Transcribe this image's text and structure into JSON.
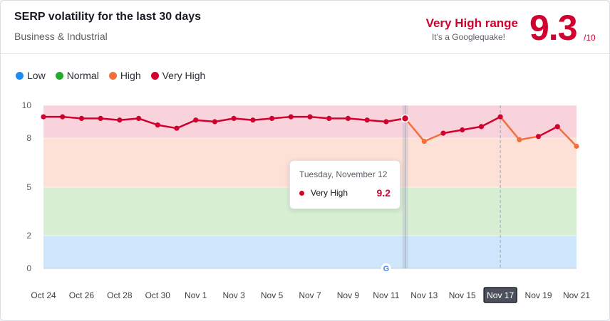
{
  "header": {
    "title": "SERP volatility for the last 30 days",
    "category": "Business & Industrial",
    "range_label": "Very High range",
    "range_sub": "It's a Googlequake!",
    "score": "9.3",
    "score_max": "/10"
  },
  "legend": [
    {
      "label": "Low",
      "color": "#1e8cf0"
    },
    {
      "label": "Normal",
      "color": "#27a82f"
    },
    {
      "label": "High",
      "color": "#f56f3a"
    },
    {
      "label": "Very High",
      "color": "#d1002f"
    }
  ],
  "tooltip": {
    "date": "Tuesday, November 12",
    "label": "Very High",
    "value": "9.2"
  },
  "chart_data": {
    "type": "line",
    "x": [
      "Oct 24",
      "Oct 25",
      "Oct 26",
      "Oct 27",
      "Oct 28",
      "Oct 29",
      "Oct 30",
      "Oct 31",
      "Nov 1",
      "Nov 2",
      "Nov 3",
      "Nov 4",
      "Nov 5",
      "Nov 6",
      "Nov 7",
      "Nov 8",
      "Nov 9",
      "Nov 10",
      "Nov 11",
      "Nov 12",
      "Nov 13",
      "Nov 14",
      "Nov 15",
      "Nov 16",
      "Nov 17",
      "Nov 18",
      "Nov 19",
      "Nov 20",
      "Nov 21"
    ],
    "values": [
      9.3,
      9.3,
      9.2,
      9.2,
      9.1,
      9.2,
      8.8,
      8.6,
      9.1,
      9.0,
      9.2,
      9.1,
      9.2,
      9.3,
      9.3,
      9.2,
      9.2,
      9.1,
      9.0,
      9.2,
      7.8,
      8.3,
      8.5,
      8.7,
      9.3,
      7.9,
      8.1,
      8.7,
      7.5
    ],
    "tick_labels": [
      "Oct 24",
      "Oct 26",
      "Oct 28",
      "Oct 30",
      "Nov 1",
      "Nov 3",
      "Nov 5",
      "Nov 7",
      "Nov 9",
      "Nov 11",
      "Nov 13",
      "Nov 15",
      "Nov 17",
      "Nov 19",
      "Nov 21"
    ],
    "highlighted_tick": "Nov 17",
    "yticks": [
      "0",
      "2",
      "5",
      "8",
      "10"
    ],
    "ylim": [
      0,
      10
    ],
    "bands": [
      {
        "name": "Low",
        "from": 0,
        "to": 2,
        "color": "#cfe7fd"
      },
      {
        "name": "Normal",
        "from": 2,
        "to": 5,
        "color": "#d8efd4"
      },
      {
        "name": "High",
        "from": 5,
        "to": 8,
        "color": "#fde0d6"
      },
      {
        "name": "Very High",
        "from": 8,
        "to": 10,
        "color": "#f8d3db"
      }
    ],
    "series_colors": {
      "very_high": "#d1002f",
      "high": "#f56f3a"
    },
    "hover_index": 19,
    "google_update_index": 18,
    "dashed_marker_index": 24,
    "grid": true
  }
}
